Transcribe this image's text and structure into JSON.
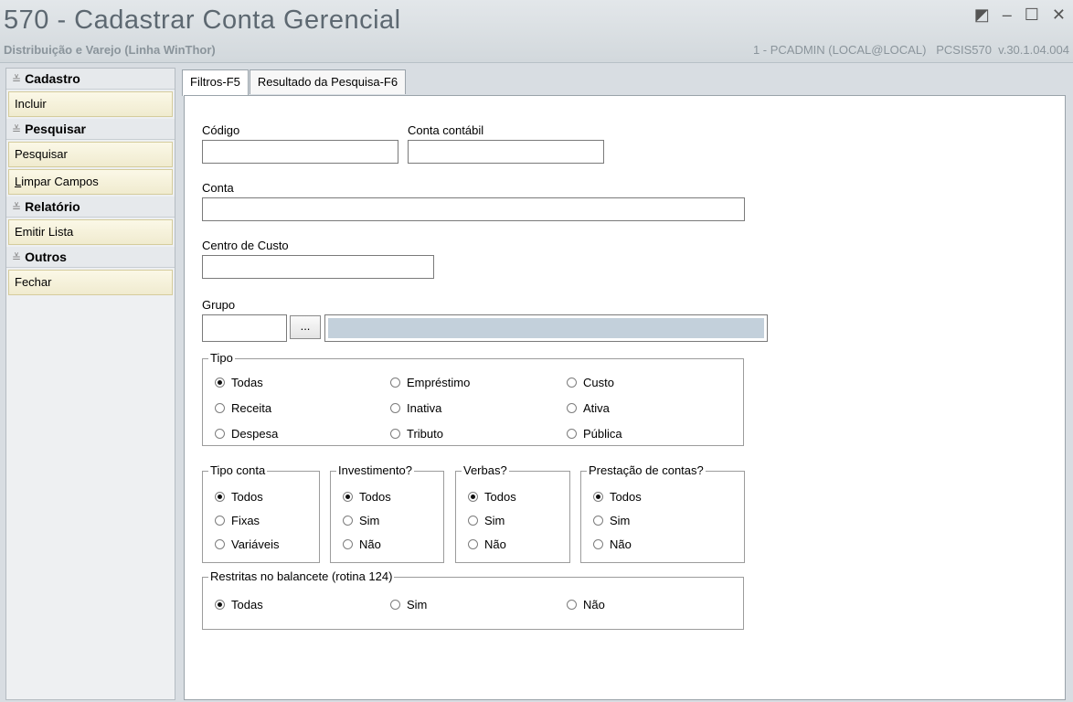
{
  "window": {
    "title": "570 - Cadastrar Conta Gerencial",
    "subtitle": "Distribuição e Varejo (Linha WinThor)",
    "user_info": "1 - PCADMIN (LOCAL@LOCAL)   PCSIS570  v.30.1.04.004",
    "controls": {
      "restore": "◩",
      "minimize": "–",
      "maximize": "☐",
      "close": "✕"
    }
  },
  "sidebar": {
    "chevron": "≚",
    "cadastro": {
      "title": "Cadastro",
      "incluir": "Incluir"
    },
    "pesquisar": {
      "title": "Pesquisar",
      "pesquisar": "Pesquisar",
      "limpar_first": "L",
      "limpar_rest": "impar Campos"
    },
    "relatorio": {
      "title": "Relatório",
      "emitir": "Emitir Lista"
    },
    "outros": {
      "title": "Outros",
      "fechar": "Fechar"
    }
  },
  "tabs": {
    "filtros": "Filtros-F5",
    "resultado": "Resultado da Pesquisa-F6"
  },
  "form": {
    "codigo": {
      "label": "Código",
      "value": ""
    },
    "conta_contabil": {
      "label": "Conta contábil",
      "value": ""
    },
    "conta": {
      "label": "Conta",
      "value": ""
    },
    "centro_custo": {
      "label": "Centro de Custo",
      "value": ""
    },
    "grupo": {
      "label": "Grupo",
      "value": "",
      "button": "..."
    },
    "tipo": {
      "legend": "Tipo",
      "options": [
        "Todas",
        "Empréstimo",
        "Custo",
        "Receita",
        "Inativa",
        "Ativa",
        "Despesa",
        "Tributo",
        "Pública"
      ],
      "selected": "Todas"
    },
    "tipo_conta": {
      "legend": "Tipo conta",
      "options": [
        "Todos",
        "Fixas",
        "Variáveis"
      ],
      "selected": "Todos"
    },
    "investimento": {
      "legend": "Investimento?",
      "options": [
        "Todos",
        "Sim",
        "Não"
      ],
      "selected": "Todos"
    },
    "verbas": {
      "legend": "Verbas?",
      "options": [
        "Todos",
        "Sim",
        "Não"
      ],
      "selected": "Todos"
    },
    "prestacao": {
      "legend": "Prestação de contas?",
      "options": [
        "Todos",
        "Sim",
        "Não"
      ],
      "selected": "Todos"
    },
    "restritas": {
      "legend": "Restritas no balancete (rotina 124)",
      "options": [
        "Todas",
        "Sim",
        "Não"
      ],
      "selected": "Todas"
    }
  },
  "colors": {
    "title_text": "#5d6871",
    "group_fill": "#c3d0db",
    "menu_item_bg": "#f5f1dc"
  }
}
